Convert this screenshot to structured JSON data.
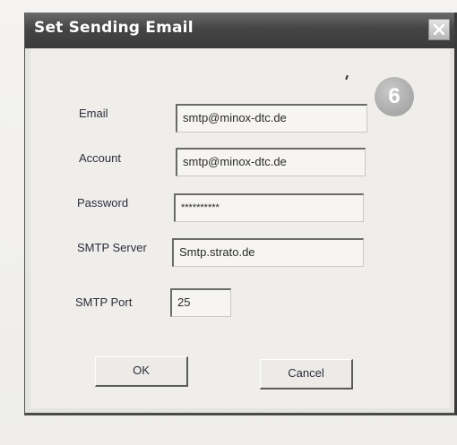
{
  "dialog": {
    "title": "Set Sending Email",
    "step_badge": "6"
  },
  "form": {
    "email_label": "Email",
    "email_value": "smtp@minox-dtc.de",
    "account_label": "Account",
    "account_value": "smtp@minox-dtc.de",
    "password_label": "Password",
    "password_value": "**********",
    "server_label": "SMTP Server",
    "server_value": "Smtp.strato.de",
    "port_label": "SMTP Port",
    "port_value": "25"
  },
  "buttons": {
    "ok_label": "OK",
    "cancel_label": "Cancel"
  },
  "icons": {
    "close": "close-icon"
  }
}
